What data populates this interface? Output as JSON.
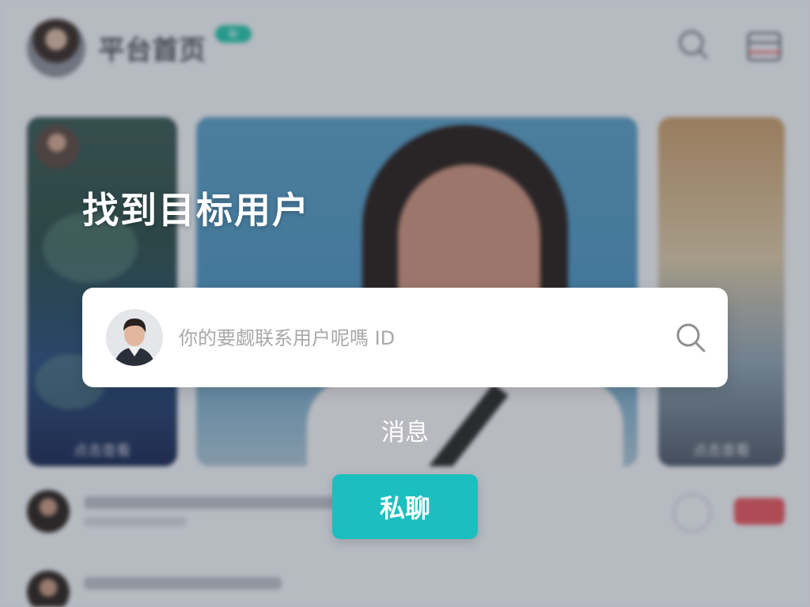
{
  "background": {
    "header_title": "平台首页",
    "header_badge": "新",
    "cards": [
      {
        "label": "点击查看"
      },
      {
        "label": ""
      },
      {
        "label": "点击查看"
      }
    ]
  },
  "dialog": {
    "title": "找到目标用户",
    "search": {
      "placeholder": "你的要觑联系用户呢嗎 ID",
      "value": ""
    },
    "message_label": "消息",
    "dm_button_label": "私聊"
  },
  "colors": {
    "accent": "#1cbfbf",
    "badge": "#28c3a9",
    "danger": "#e2575f"
  },
  "icons": {
    "search": "search-icon",
    "menu": "menu-icon",
    "avatar": "avatar"
  }
}
